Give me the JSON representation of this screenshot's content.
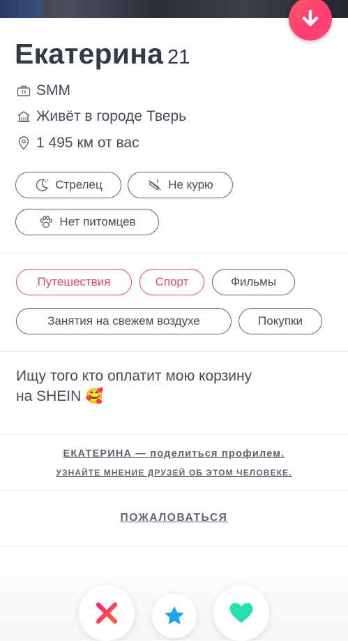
{
  "profile": {
    "name": "Екатерина",
    "age": "21",
    "job": "SMM",
    "city": "Живёт в городе Тверь",
    "distance": "1 495 км от вас"
  },
  "basics": [
    {
      "label": "Стрелец",
      "icon": "zodiac-moon-icon"
    },
    {
      "label": "Не курю",
      "icon": "no-smoking-icon"
    },
    {
      "label": "Нет питомцев",
      "icon": "paw-icon"
    }
  ],
  "interests": [
    {
      "label": "Путешествия",
      "shared": true
    },
    {
      "label": "Спорт",
      "shared": true
    },
    {
      "label": "Фильмы",
      "shared": false
    },
    {
      "label": "Занятия на свежем воздухе",
      "shared": false
    },
    {
      "label": "Покупки",
      "shared": false
    }
  ],
  "bio": {
    "line1": "Ищу того кто оплатит мою корзину",
    "line2": "на SHEIN 🥰"
  },
  "share": {
    "title": "ЕКАТЕРИНА — поделиться профилем.",
    "subtitle": "УЗНАЙТЕ МНЕНИЕ ДРУЗЕЙ ОБ ЭТОМ ЧЕЛОВЕКЕ."
  },
  "report_label": "ПОЖАЛОВАТЬСЯ",
  "colors": {
    "brand": "#fe3c72",
    "accent_pill": "#e2466b",
    "nope": "#fd5068",
    "super_like": "#1fa2f2",
    "like": "#2ee3a8"
  }
}
